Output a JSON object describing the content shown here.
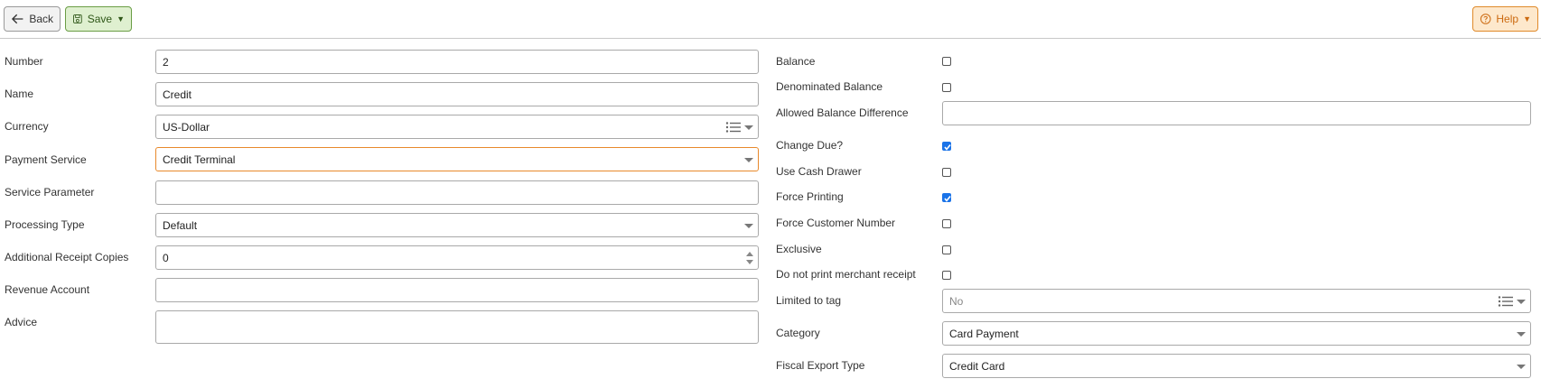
{
  "toolbar": {
    "back_label": "Back",
    "save_label": "Save",
    "help_label": "Help"
  },
  "left_form": {
    "number": {
      "label": "Number",
      "value": "2"
    },
    "name": {
      "label": "Name",
      "value": "Credit"
    },
    "currency": {
      "label": "Currency",
      "value": "US-Dollar"
    },
    "payment_service": {
      "label": "Payment Service",
      "value": "Credit Terminal"
    },
    "service_parameter": {
      "label": "Service Parameter",
      "value": ""
    },
    "processing_type": {
      "label": "Processing Type",
      "value": "Default"
    },
    "additional_receipt_copies": {
      "label": "Additional Receipt Copies",
      "value": "0"
    },
    "revenue_account": {
      "label": "Revenue Account",
      "value": ""
    },
    "advice": {
      "label": "Advice",
      "value": ""
    }
  },
  "right_form": {
    "balance": {
      "label": "Balance",
      "checked": false
    },
    "denominated_balance": {
      "label": "Denominated Balance",
      "checked": false
    },
    "allowed_balance_difference": {
      "label": "Allowed Balance Difference",
      "value": ""
    },
    "change_due": {
      "label": "Change Due?",
      "checked": true
    },
    "use_cash_drawer": {
      "label": "Use Cash Drawer",
      "checked": false
    },
    "force_printing": {
      "label": "Force Printing",
      "checked": true
    },
    "force_customer_number": {
      "label": "Force Customer Number",
      "checked": false
    },
    "exclusive": {
      "label": "Exclusive",
      "checked": false
    },
    "do_not_print_merchant_receipt": {
      "label": "Do not print merchant receipt",
      "checked": false
    },
    "limited_to_tag": {
      "label": "Limited to tag",
      "value": "No"
    },
    "category": {
      "label": "Category",
      "value": "Card Payment"
    },
    "fiscal_export_type": {
      "label": "Fiscal Export Type",
      "value": "Credit Card"
    }
  },
  "colors": {
    "focus_border": "#e8892b",
    "save_bg": "#dff0d0",
    "help_bg": "#fde8cc",
    "checkbox_checked": "#1a73e8"
  }
}
